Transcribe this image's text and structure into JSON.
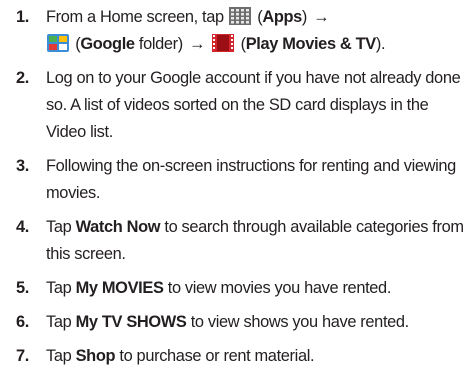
{
  "steps": [
    {
      "number": "1.",
      "parts": {
        "a": "From a Home screen, tap",
        "apps_icon": "apps-grid-icon",
        "apps_label": "Apps",
        "arrow": "→",
        "google_icon": "google-folder-icon",
        "google_label": "Google",
        "google_suffix": " folder)",
        "play_icon": "play-movies-icon",
        "play_label": "Play Movies & TV"
      }
    },
    {
      "number": "2.",
      "text": "Log on to your Google account if you have not already done so. A list of videos sorted on the SD card displays in the Video list."
    },
    {
      "number": "3.",
      "text": "Following the on-screen instructions for renting and viewing movies."
    },
    {
      "number": "4.",
      "pre": "Tap ",
      "bold": "Watch Now",
      "post": " to search through available categories from this screen."
    },
    {
      "number": "5.",
      "pre": "Tap ",
      "bold": "My MOVIES",
      "post": " to view movies you have rented."
    },
    {
      "number": "6.",
      "pre": "Tap ",
      "bold": "My TV SHOWS",
      "post": " to view shows you have rented."
    },
    {
      "number": "7.",
      "pre": "Tap ",
      "bold": "Shop",
      "post": " to purchase or rent material."
    }
  ],
  "colors": {
    "text": "#231f20",
    "play_red": "#d3262c",
    "google_blue": "#3b8ed6",
    "apps_grey": "#8a8a8a"
  }
}
